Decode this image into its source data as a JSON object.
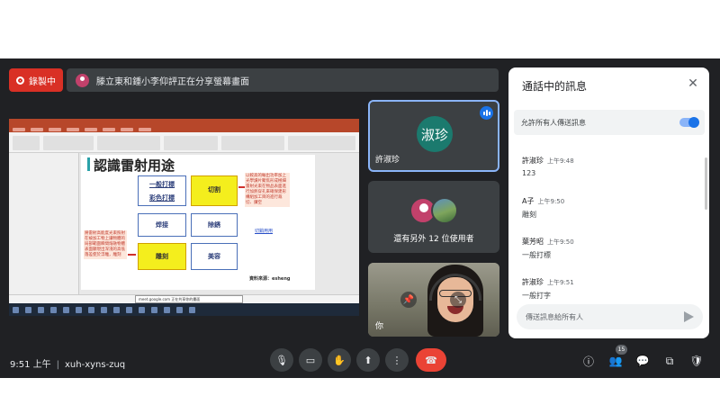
{
  "recording": {
    "label": "錄製中"
  },
  "banner": {
    "text": "滕立東和鍾小李仰評正在分享螢幕畫面"
  },
  "presentation": {
    "slide_title": "認識雷射用途",
    "boxes": [
      "一般打標",
      "彩色打標",
      "切割",
      "焊接",
      "除銹",
      "雕刻",
      "美容"
    ],
    "note_right": "以較高的輸出功率加上光學讀片聚焦形成極細雷射光束在物品表面進行加熱穿孔來確保建形構組加工目的進行裁切、鑽空",
    "note_left": "將雷射高能度光束照射在被加工物上讓物體的局部範圍瞬間熔融物體表面顯現出深淺的高低落差使於浮雕，雕刻",
    "link": "切銷用用",
    "source": "資料來源：esheng",
    "popup": "meet.google.com 正在共享你的畫面"
  },
  "tiles": {
    "presenter": {
      "initials": "淑珍",
      "name": "許淑珍"
    },
    "others": {
      "label": "還有另外 12 位使用者"
    },
    "self": {
      "label": "你"
    }
  },
  "chat": {
    "title": "通話中的訊息",
    "allow_label": "允許所有人傳送訊息",
    "allow_on": true,
    "messages": [
      {
        "sender": "許淑珍",
        "time": "上午9:48",
        "text": "123"
      },
      {
        "sender": "A子",
        "time": "上午9:50",
        "text": "雕刻"
      },
      {
        "sender": "葉芳昭",
        "time": "上午9:50",
        "text": "一般打標"
      },
      {
        "sender": "許淑珍",
        "time": "上午9:51",
        "text": "一般打字"
      }
    ],
    "input_placeholder": "傳送訊息給所有人"
  },
  "bottom": {
    "time": "9:51 上午",
    "meeting_code": "xuh-xyns-zuq",
    "participant_count": "15"
  },
  "colors": {
    "accent": "#1a73e8",
    "end_call": "#ea4335",
    "recording": "#d93025",
    "background": "#202124"
  }
}
